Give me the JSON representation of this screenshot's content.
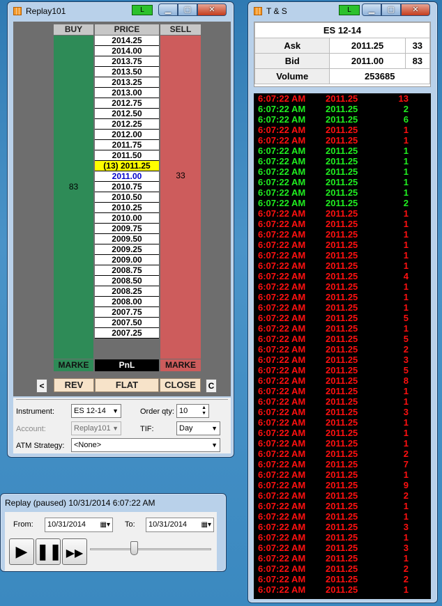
{
  "replay101": {
    "title": "Replay101",
    "link_label": "L",
    "headers": {
      "buy": "BUY",
      "price": "PRICE",
      "sell": "SELL"
    },
    "prices": [
      "2014.25",
      "2014.00",
      "2013.75",
      "2013.50",
      "2013.25",
      "2013.00",
      "2012.75",
      "2012.50",
      "2012.25",
      "2012.00",
      "2011.75",
      "2011.50",
      "(13) 2011.25",
      "2011.00",
      "2010.75",
      "2010.50",
      "2010.25",
      "2010.00",
      "2009.75",
      "2009.50",
      "2009.25",
      "2009.00",
      "2008.75",
      "2008.50",
      "2008.25",
      "2008.00",
      "2007.75",
      "2007.50",
      "2007.25"
    ],
    "ask_qty": "33",
    "bid_qty": "83",
    "market_buy": "MARKE",
    "pnl": "PnL",
    "market_sell": "MARKE",
    "buttons": {
      "left": "<",
      "rev": "REV",
      "flat": "FLAT",
      "close": "CLOSE",
      "c": "C"
    },
    "form": {
      "instrument_label": "Instrument:",
      "instrument_value": "ES 12-14",
      "order_qty_label": "Order qty:",
      "order_qty_value": "10",
      "account_label": "Account:",
      "account_value": "Replay101",
      "tif_label": "TIF:",
      "tif_value": "Day",
      "atm_label": "ATM Strategy:",
      "atm_value": "<None>"
    }
  },
  "ts": {
    "title": "T & S",
    "link_label": "L",
    "instrument": "ES 12-14",
    "ask_label": "Ask",
    "ask_price": "2011.25",
    "ask_size": "33",
    "bid_label": "Bid",
    "bid_price": "2011.00",
    "bid_size": "83",
    "volume_label": "Volume",
    "volume": "253685",
    "trades": [
      {
        "time": "6:07:22 AM",
        "price": "2011.25",
        "size": "13",
        "side": "red"
      },
      {
        "time": "6:07:22 AM",
        "price": "2011.25",
        "size": "2",
        "side": "green"
      },
      {
        "time": "6:07:22 AM",
        "price": "2011.25",
        "size": "6",
        "side": "green"
      },
      {
        "time": "6:07:22 AM",
        "price": "2011.25",
        "size": "1",
        "side": "red"
      },
      {
        "time": "6:07:22 AM",
        "price": "2011.25",
        "size": "1",
        "side": "red"
      },
      {
        "time": "6:07:22 AM",
        "price": "2011.25",
        "size": "1",
        "side": "green"
      },
      {
        "time": "6:07:22 AM",
        "price": "2011.25",
        "size": "1",
        "side": "green"
      },
      {
        "time": "6:07:22 AM",
        "price": "2011.25",
        "size": "1",
        "side": "green"
      },
      {
        "time": "6:07:22 AM",
        "price": "2011.25",
        "size": "1",
        "side": "green"
      },
      {
        "time": "6:07:22 AM",
        "price": "2011.25",
        "size": "1",
        "side": "green"
      },
      {
        "time": "6:07:22 AM",
        "price": "2011.25",
        "size": "2",
        "side": "green"
      },
      {
        "time": "6:07:22 AM",
        "price": "2011.25",
        "size": "1",
        "side": "red"
      },
      {
        "time": "6:07:22 AM",
        "price": "2011.25",
        "size": "1",
        "side": "red"
      },
      {
        "time": "6:07:22 AM",
        "price": "2011.25",
        "size": "1",
        "side": "red"
      },
      {
        "time": "6:07:22 AM",
        "price": "2011.25",
        "size": "1",
        "side": "red"
      },
      {
        "time": "6:07:22 AM",
        "price": "2011.25",
        "size": "1",
        "side": "red"
      },
      {
        "time": "6:07:22 AM",
        "price": "2011.25",
        "size": "1",
        "side": "red"
      },
      {
        "time": "6:07:22 AM",
        "price": "2011.25",
        "size": "4",
        "side": "red"
      },
      {
        "time": "6:07:22 AM",
        "price": "2011.25",
        "size": "1",
        "side": "red"
      },
      {
        "time": "6:07:22 AM",
        "price": "2011.25",
        "size": "1",
        "side": "red"
      },
      {
        "time": "6:07:22 AM",
        "price": "2011.25",
        "size": "1",
        "side": "red"
      },
      {
        "time": "6:07:22 AM",
        "price": "2011.25",
        "size": "5",
        "side": "red"
      },
      {
        "time": "6:07:22 AM",
        "price": "2011.25",
        "size": "1",
        "side": "red"
      },
      {
        "time": "6:07:22 AM",
        "price": "2011.25",
        "size": "5",
        "side": "red"
      },
      {
        "time": "6:07:22 AM",
        "price": "2011.25",
        "size": "2",
        "side": "red"
      },
      {
        "time": "6:07:22 AM",
        "price": "2011.25",
        "size": "3",
        "side": "red"
      },
      {
        "time": "6:07:22 AM",
        "price": "2011.25",
        "size": "5",
        "side": "red"
      },
      {
        "time": "6:07:22 AM",
        "price": "2011.25",
        "size": "8",
        "side": "red"
      },
      {
        "time": "6:07:22 AM",
        "price": "2011.25",
        "size": "1",
        "side": "red"
      },
      {
        "time": "6:07:22 AM",
        "price": "2011.25",
        "size": "1",
        "side": "red"
      },
      {
        "time": "6:07:22 AM",
        "price": "2011.25",
        "size": "3",
        "side": "red"
      },
      {
        "time": "6:07:22 AM",
        "price": "2011.25",
        "size": "1",
        "side": "red"
      },
      {
        "time": "6:07:22 AM",
        "price": "2011.25",
        "size": "1",
        "side": "red"
      },
      {
        "time": "6:07:22 AM",
        "price": "2011.25",
        "size": "1",
        "side": "red"
      },
      {
        "time": "6:07:22 AM",
        "price": "2011.25",
        "size": "2",
        "side": "red"
      },
      {
        "time": "6:07:22 AM",
        "price": "2011.25",
        "size": "7",
        "side": "red"
      },
      {
        "time": "6:07:22 AM",
        "price": "2011.25",
        "size": "1",
        "side": "red"
      },
      {
        "time": "6:07:22 AM",
        "price": "2011.25",
        "size": "9",
        "side": "red"
      },
      {
        "time": "6:07:22 AM",
        "price": "2011.25",
        "size": "2",
        "side": "red"
      },
      {
        "time": "6:07:22 AM",
        "price": "2011.25",
        "size": "1",
        "side": "red"
      },
      {
        "time": "6:07:22 AM",
        "price": "2011.25",
        "size": "1",
        "side": "red"
      },
      {
        "time": "6:07:22 AM",
        "price": "2011.25",
        "size": "3",
        "side": "red"
      },
      {
        "time": "6:07:22 AM",
        "price": "2011.25",
        "size": "1",
        "side": "red"
      },
      {
        "time": "6:07:22 AM",
        "price": "2011.25",
        "size": "3",
        "side": "red"
      },
      {
        "time": "6:07:22 AM",
        "price": "2011.25",
        "size": "1",
        "side": "red"
      },
      {
        "time": "6:07:22 AM",
        "price": "2011.25",
        "size": "2",
        "side": "red"
      },
      {
        "time": "6:07:22 AM",
        "price": "2011.25",
        "size": "2",
        "side": "red"
      },
      {
        "time": "6:07:22 AM",
        "price": "2011.25",
        "size": "1",
        "side": "red"
      }
    ]
  },
  "replay": {
    "title": "Replay (paused) 10/31/2014 6:07:22 AM",
    "from_label": "From:",
    "from_value": "10/31/2014",
    "to_label": "To:",
    "to_value": "10/31/2014",
    "play_icon": "play-icon",
    "pause_icon": "pause-icon",
    "ff_icon": "fast-forward-icon"
  }
}
